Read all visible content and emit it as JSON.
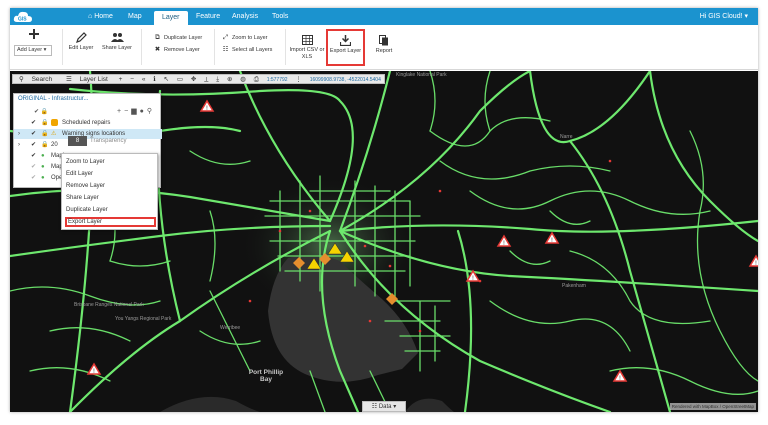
{
  "app": {
    "logo_text": "GIS",
    "greeting": "Hi GIS Cloud!"
  },
  "nav": [
    {
      "label": "Home",
      "icon": "home-icon"
    },
    {
      "label": "Map"
    },
    {
      "label": "Layer",
      "active": true
    },
    {
      "label": "Feature"
    },
    {
      "label": "Analysis"
    },
    {
      "label": "Tools"
    }
  ],
  "ribbon": {
    "add_layer": "Add Layer",
    "edit_layer": "Edit Layer",
    "share_layer": "Share Layer",
    "duplicate_layer": "Duplicate Layer",
    "remove_layer": "Remove Layer",
    "zoom_to_layer": "Zoom to Layer",
    "select_all_layers": "Select all Layers",
    "import_csv": "Import CSV or XLS",
    "export_layer": "Export Layer",
    "report": "Report"
  },
  "maptool": {
    "search": "Search",
    "layer_list": "Layer List",
    "scale": "1:577792",
    "coords": "16099908.9738, -4522014.5404"
  },
  "panel": {
    "title": "ORIGINAL - Infrastructur...",
    "layers": [
      {
        "name": "Scheduled repairs",
        "icon": "pedestrian-icon"
      },
      {
        "name": "Warning signs locations",
        "icon": "warning-icon",
        "selected": true
      },
      {
        "name": "20"
      },
      {
        "name": "Mapb"
      },
      {
        "name": "Mapb"
      },
      {
        "name": "Open"
      }
    ],
    "tooltip_value": "8",
    "tooltip_label": "Transparency"
  },
  "context_menu": [
    "Zoom to Layer",
    "Edit Layer",
    "Remove Layer",
    "Share Layer",
    "Duplicate Layer",
    "Export Layer"
  ],
  "map_labels": {
    "kinglake": "Kinglake National Park",
    "narre": "Narre",
    "brisbane": "Brisbane Ranges National Park",
    "you_yangs": "You Yangs Regional Park",
    "werribee": "Werribee",
    "port_phillip": "Port Phillip Bay",
    "pakenham": "Pakenham"
  },
  "data_tab": "Data",
  "attribution": "Rendered with MapBox / OpenStreetMap",
  "colors": {
    "topbar": "#1b93cf",
    "roads": "#6ee86e",
    "highlight": "#e53935",
    "map_bg": "#111111"
  }
}
